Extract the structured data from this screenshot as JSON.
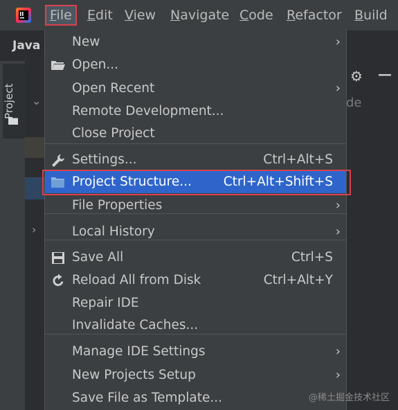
{
  "menubar": {
    "items": [
      {
        "label": "File",
        "mnemonic_index": 0
      },
      {
        "label": "Edit",
        "mnemonic_index": 0
      },
      {
        "label": "View",
        "mnemonic_index": 0
      },
      {
        "label": "Navigate",
        "mnemonic_index": 0
      },
      {
        "label": "Code",
        "mnemonic_index": 0
      },
      {
        "label": "Refactor",
        "mnemonic_index": 0
      },
      {
        "label": "Build",
        "mnemonic_index": 0
      }
    ],
    "active_index": 0
  },
  "background": {
    "tab_label": "Java",
    "project_tool_label": "Project",
    "partial_text": "de"
  },
  "file_menu": {
    "items": [
      {
        "label": "New",
        "shortcut": "",
        "submenu": true,
        "icon": ""
      },
      {
        "label": "Open...",
        "shortcut": "",
        "submenu": false,
        "icon": "open-folder-icon"
      },
      {
        "label": "Open Recent",
        "shortcut": "",
        "submenu": true,
        "icon": ""
      },
      {
        "label": "Remote Development...",
        "shortcut": "",
        "submenu": false,
        "icon": ""
      },
      {
        "label": "Close Project",
        "shortcut": "",
        "submenu": false,
        "icon": ""
      },
      {
        "label": "Settings...",
        "shortcut": "Ctrl+Alt+S",
        "submenu": false,
        "icon": "wrench-icon"
      },
      {
        "label": "Project Structure...",
        "shortcut": "Ctrl+Alt+Shift+S",
        "submenu": false,
        "icon": "project-structure-icon",
        "selected": true
      },
      {
        "label": "File Properties",
        "shortcut": "",
        "submenu": true,
        "icon": ""
      },
      {
        "label": "Local History",
        "shortcut": "",
        "submenu": true,
        "icon": ""
      },
      {
        "label": "Save All",
        "shortcut": "Ctrl+S",
        "submenu": false,
        "icon": "save-icon"
      },
      {
        "label": "Reload All from Disk",
        "shortcut": "Ctrl+Alt+Y",
        "submenu": false,
        "icon": "reload-icon"
      },
      {
        "label": "Repair IDE",
        "shortcut": "",
        "submenu": false,
        "icon": ""
      },
      {
        "label": "Invalidate Caches...",
        "shortcut": "",
        "submenu": false,
        "icon": ""
      },
      {
        "label": "Manage IDE Settings",
        "shortcut": "",
        "submenu": true,
        "icon": ""
      },
      {
        "label": "New Projects Setup",
        "shortcut": "",
        "submenu": true,
        "icon": ""
      },
      {
        "label": "Save File as Template...",
        "shortcut": "",
        "submenu": false,
        "icon": ""
      }
    ]
  },
  "watermark": "@稀土掘金技术社区"
}
